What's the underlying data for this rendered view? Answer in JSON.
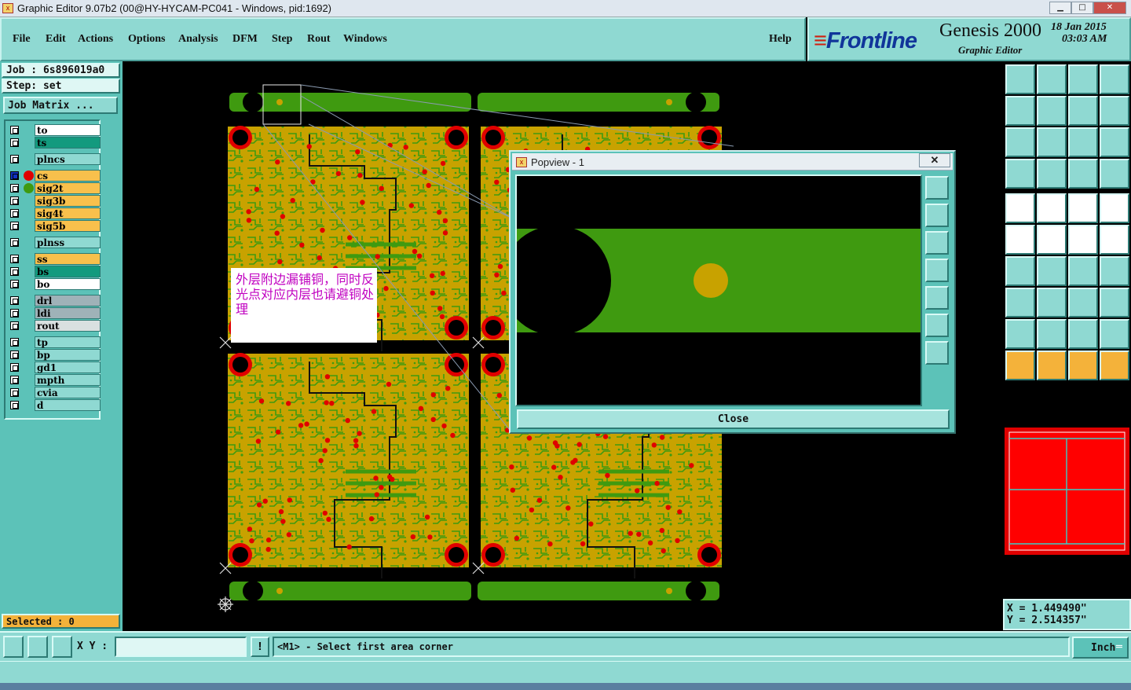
{
  "window": {
    "title": "Graphic Editor 9.07b2 (00@HY-HYCAM-PC041 - Windows, pid:1692)"
  },
  "menu": {
    "items": [
      "File",
      "Edit",
      "Actions",
      "Options",
      "Analysis",
      "DFM",
      "Step",
      "Rout",
      "Windows"
    ],
    "help": "Help"
  },
  "brand": {
    "logo": "Frontline",
    "product": "Genesis 2000",
    "subtitle": "Graphic Editor",
    "date": "18 Jan 2015",
    "time": "03:03 AM"
  },
  "job": {
    "job_line": "Job : 6s896019a0",
    "step_line": "Step: set",
    "matrix_button": "Job Matrix ..."
  },
  "layers": [
    {
      "name": "to",
      "color": "#ffffff"
    },
    {
      "name": "ts",
      "color": "#139a7e"
    },
    {
      "name": "plncs",
      "color": "#8fd9d2"
    },
    {
      "name": "cs",
      "color": "#f8c04c"
    },
    {
      "name": "sig2t",
      "color": "#f8c04c"
    },
    {
      "name": "sig3b",
      "color": "#f8c04c"
    },
    {
      "name": "sig4t",
      "color": "#f8c04c"
    },
    {
      "name": "sig5b",
      "color": "#f8c04c"
    },
    {
      "name": "plnss",
      "color": "#8fd9d2"
    },
    {
      "name": "ss",
      "color": "#f8c04c"
    },
    {
      "name": "bs",
      "color": "#139a7e"
    },
    {
      "name": "bo",
      "color": "#ffffff"
    },
    {
      "name": "drl",
      "color": "#9fb2b8"
    },
    {
      "name": "ldi",
      "color": "#9fb2b8"
    },
    {
      "name": "rout",
      "color": "#d9e0e0"
    },
    {
      "name": "tp",
      "color": "#8fd9d2"
    },
    {
      "name": "bp",
      "color": "#8fd9d2"
    },
    {
      "name": "gd1",
      "color": "#8fd9d2"
    },
    {
      "name": "mpth",
      "color": "#8fd9d2"
    },
    {
      "name": "cvia",
      "color": "#8fd9d2"
    },
    {
      "name": "d",
      "color": "#8fd9d2"
    }
  ],
  "selected": "Selected : 0",
  "note": {
    "text": "外层附边漏铺铜，同时反光点对应内层也请避铜处理"
  },
  "popview": {
    "title": "Popview - 1",
    "close_label": "Close"
  },
  "coords": {
    "x": "X = 1.449490\"",
    "y": "Y = 2.514357\""
  },
  "status": {
    "xy_label": "X Y :",
    "xy_value": "",
    "warn": "!",
    "message": "<M1> - Select first area corner",
    "units": "Inch"
  },
  "colors": {
    "panel": "#8fd9d2",
    "copper": "#c8a200",
    "green": "#3f9a10",
    "pad": "#e00000"
  }
}
